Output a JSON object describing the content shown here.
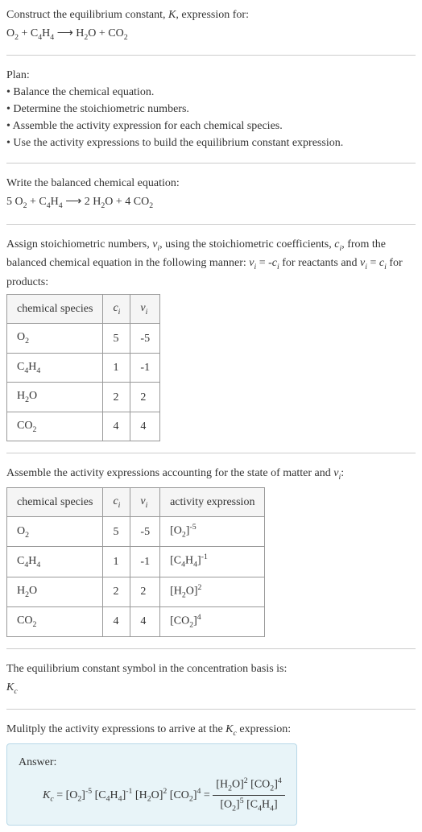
{
  "intro": {
    "line1": "Construct the equilibrium constant, ",
    "K": "K",
    "line1_end": ", expression for:",
    "eq_o2": "O",
    "eq_plus": " + C",
    "eq_h4": "H",
    "arrow": " ⟶ H",
    "eq_o": "O + CO"
  },
  "plan": {
    "title": "Plan:",
    "item1": "• Balance the chemical equation.",
    "item2": "• Determine the stoichiometric numbers.",
    "item3": "• Assemble the activity expression for each chemical species.",
    "item4": "• Use the activity expressions to build the equilibrium constant expression."
  },
  "balanced": {
    "title": "Write the balanced chemical equation:",
    "eq": "5 O",
    "plus1": " + C",
    "h": "H",
    "arrow": " ⟶ 2 H",
    "o_plus": "O + 4 CO"
  },
  "assign": {
    "text1": "Assign stoichiometric numbers, ",
    "nu_i": "ν",
    "text2": ", using the stoichiometric coefficients, ",
    "c_i": "c",
    "text3": ", from the balanced chemical equation in the following manner: ",
    "eq1": " = -",
    "text4": " for reactants and ",
    "eq2": " = ",
    "text5": " for products:"
  },
  "table1": {
    "h1": "chemical species",
    "h2": "c",
    "h3": "ν",
    "rows": [
      {
        "species": "O",
        "species_sub": "2",
        "c": "5",
        "nu": "-5"
      },
      {
        "species": "C",
        "species_sub": "4",
        "species2": "H",
        "species_sub2": "4",
        "c": "1",
        "nu": "-1"
      },
      {
        "species": "H",
        "species_sub": "2",
        "species2": "O",
        "c": "2",
        "nu": "2"
      },
      {
        "species": "CO",
        "species_sub": "2",
        "c": "4",
        "nu": "4"
      }
    ]
  },
  "assemble": {
    "text1": "Assemble the activity expressions accounting for the state of matter and ",
    "nu": "ν",
    "text2": ":"
  },
  "table2": {
    "h1": "chemical species",
    "h2": "c",
    "h3": "ν",
    "h4": "activity expression"
  },
  "symbol": {
    "text": "The equilibrium constant symbol in the concentration basis is:",
    "kc": "K"
  },
  "multiply": {
    "text1": "Mulitply the activity expressions to arrive at the ",
    "kc": "K",
    "text2": " expression:"
  },
  "answer": {
    "label": "Answer:",
    "kc": "K",
    "eq": " = [O",
    "c4h4": " [C",
    "h2o": " [H",
    "co2": " [CO",
    "frac_eq": " = "
  },
  "subs": {
    "two": "2",
    "four": "4",
    "i": "i",
    "c": "c",
    "five": "5",
    "one": "1",
    "neg5": "-5",
    "neg1": "-1"
  }
}
